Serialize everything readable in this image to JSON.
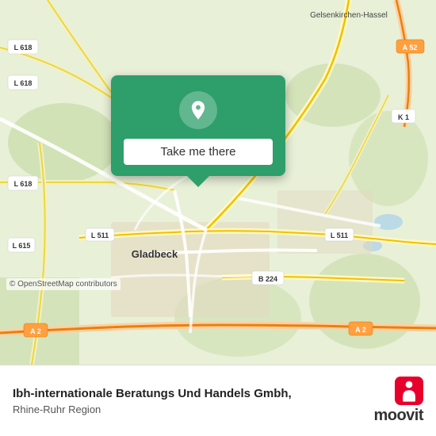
{
  "map": {
    "background_color": "#e8f0d8",
    "osm_attribution": "© OpenStreetMap contributors"
  },
  "popup": {
    "button_label": "Take me there",
    "bg_color": "#2e9e6b"
  },
  "business": {
    "name": "Ibh-internationale Beratungs Und Handels Gmbh,",
    "region": "Rhine-Ruhr Region"
  },
  "moovit": {
    "wordmark": "moovit"
  },
  "road_labels": [
    {
      "id": "l618_top",
      "text": "L 618"
    },
    {
      "id": "l618_mid",
      "text": "L 618"
    },
    {
      "id": "l618_left",
      "text": "L 618"
    },
    {
      "id": "l615",
      "text": "L 615"
    },
    {
      "id": "l511_left",
      "text": "L 511"
    },
    {
      "id": "l511_right",
      "text": "L 511"
    },
    {
      "id": "b224",
      "text": "B 224"
    },
    {
      "id": "a52",
      "text": "A 52"
    },
    {
      "id": "a2_left",
      "text": "A 2"
    },
    {
      "id": "a2_right",
      "text": "A 2"
    },
    {
      "id": "k1",
      "text": "K 1"
    },
    {
      "id": "gladbeck",
      "text": "Gladbeck"
    },
    {
      "id": "gelsenkirchen",
      "text": "Gelsenkirchen-Hassel"
    }
  ]
}
